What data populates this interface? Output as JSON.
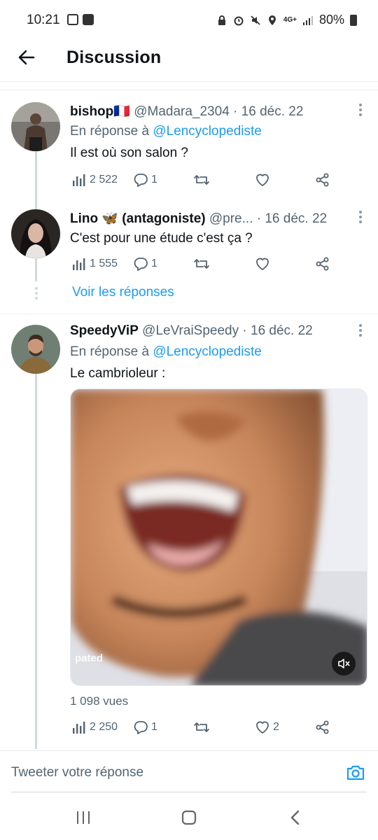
{
  "status_bar": {
    "time": "10:21",
    "battery": "80%",
    "network": "4G+"
  },
  "header": {
    "title": "Discussion"
  },
  "tweets": [
    {
      "name": "bishop🇫🇷",
      "handle": "@Madara_2304",
      "sep": "·",
      "date": "16 déc. 22",
      "reply_prefix": "En réponse à",
      "reply_to": "@Lencyclopediste",
      "text": "Il est où son salon ?",
      "views": "2 522",
      "replies": "1",
      "retweets": "",
      "likes": ""
    },
    {
      "name": "Lino 🦋 (antagoniste)",
      "handle": "@pre...",
      "sep": "·",
      "date": "16 déc. 22",
      "text": "C'est pour une étude c'est ça ?",
      "views": "1 555",
      "replies": "1",
      "retweets": "",
      "likes": ""
    },
    {
      "name": "SpeedyViP",
      "handle": "@LeVraiSpeedy",
      "sep": "·",
      "date": "16 déc. 22",
      "reply_prefix": "En réponse à",
      "reply_to": "@Lencyclopediste",
      "text": "Le cambrioleur :",
      "media_label": "pated",
      "video_views": "1 098 vues",
      "views": "2 250",
      "replies": "1",
      "retweets": "",
      "likes": "2"
    }
  ],
  "see_replies": "Voir les réponses",
  "composer": {
    "placeholder": "Tweeter votre réponse"
  },
  "colors": {
    "accent": "#1d9bf0",
    "secondary_text": "#536471",
    "thread_line": "#cfd9de"
  }
}
